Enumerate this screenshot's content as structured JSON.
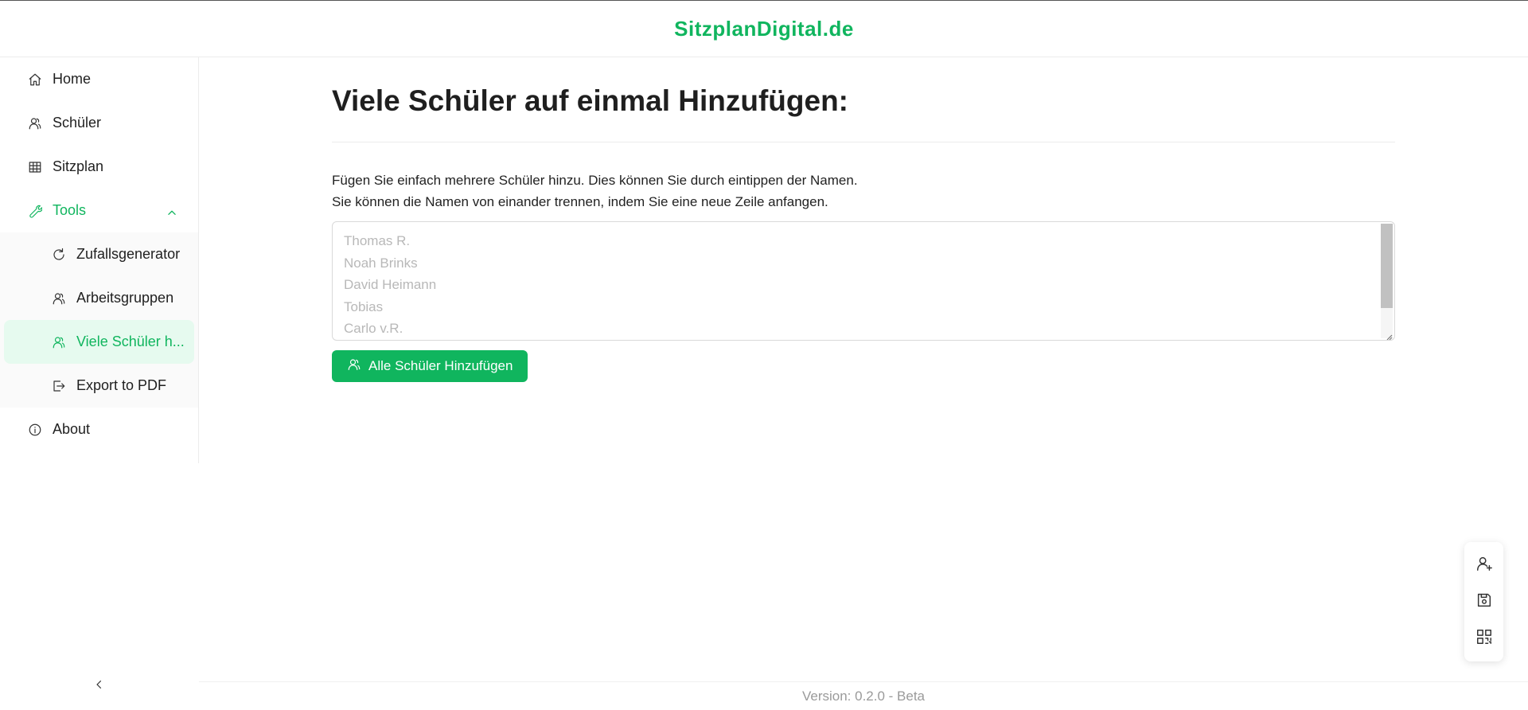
{
  "app": {
    "brand": "SitzplanDigital.de"
  },
  "sidebar": {
    "items": [
      {
        "label": "Home",
        "icon": "home-icon"
      },
      {
        "label": "Schüler",
        "icon": "users-icon"
      },
      {
        "label": "Sitzplan",
        "icon": "table-icon"
      },
      {
        "label": "Tools",
        "icon": "wrench-icon",
        "expanded": true
      }
    ],
    "tools_submenu": [
      {
        "label": "Zufallsgenerator",
        "icon": "refresh-icon"
      },
      {
        "label": "Arbeitsgruppen",
        "icon": "users-icon"
      },
      {
        "label": "Viele Schüler h...",
        "icon": "users-icon",
        "active": true
      },
      {
        "label": "Export to PDF",
        "icon": "export-icon"
      }
    ],
    "about": {
      "label": "About",
      "icon": "info-icon"
    },
    "collapse_icon": "chevron-left-icon"
  },
  "main": {
    "title": "Viele Schüler auf einmal Hinzufügen:",
    "description_line1": "Fügen Sie einfach mehrere Schüler hinzu. Dies können Sie durch eintippen der Namen.",
    "description_line2": "Sie können die Namen von einander trennen, indem Sie eine neue Zeile anfangen.",
    "textarea": {
      "value": "",
      "placeholder": "Thomas R.\nNoah Brinks\nDavid Heimann\nTobias\nCarlo v.R."
    },
    "add_button_label": "Alle Schüler Hinzufügen"
  },
  "float_panel": {
    "buttons": [
      "add-user-icon",
      "save-icon",
      "qr-code-icon"
    ]
  },
  "footer": {
    "version": "Version: 0.2.0 - Beta"
  },
  "colors": {
    "accent": "#10b55e",
    "active_bg": "#e6faef"
  }
}
